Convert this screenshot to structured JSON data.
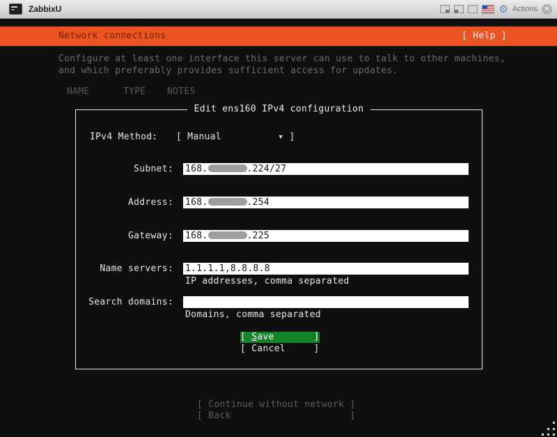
{
  "window": {
    "title": "ZabbixU",
    "actions_label": "Actions"
  },
  "header": {
    "title": "Network connections",
    "help": "[ Help ]"
  },
  "intro": {
    "line1": "Configure at least one interface this server can use to talk to other machines,",
    "line2": "and which preferably provides sufficient access for updates."
  },
  "columns": {
    "name": "NAME",
    "type": "TYPE",
    "notes": "NOTES"
  },
  "dialog": {
    "title": "Edit ens160 IPv4 configuration",
    "method": {
      "label": "IPv4 Method:",
      "value": "[ Manual          ▾ ]",
      "selected": "Manual"
    },
    "subnet": {
      "label": "Subnet:",
      "prefix": "168.",
      "suffix": ".224/27",
      "redacted": true
    },
    "address": {
      "label": "Address:",
      "prefix": "168.",
      "suffix": ".254",
      "redacted": true
    },
    "gateway": {
      "label": "Gateway:",
      "prefix": "168.",
      "suffix": ".225",
      "redacted": true
    },
    "nameservers": {
      "label": "Name servers:",
      "value": "1.1.1.1,8.8.8.8",
      "help": "IP addresses, comma separated"
    },
    "search_domains": {
      "label": "Search domains:",
      "value": "",
      "help": "Domains, comma separated"
    },
    "save": {
      "open": "[ ",
      "accel": "S",
      "rest": "ave",
      "close": "       ]"
    },
    "cancel_label": "[ Cancel     ]"
  },
  "footer": {
    "continue_label": "[ Continue without network ]",
    "back_label": "[ Back                     ]"
  },
  "colors": {
    "accent_orange": "#e95420",
    "header_text": "#7a1f04",
    "save_green": "#128328",
    "redaction_gray": "#9e9e9e"
  }
}
